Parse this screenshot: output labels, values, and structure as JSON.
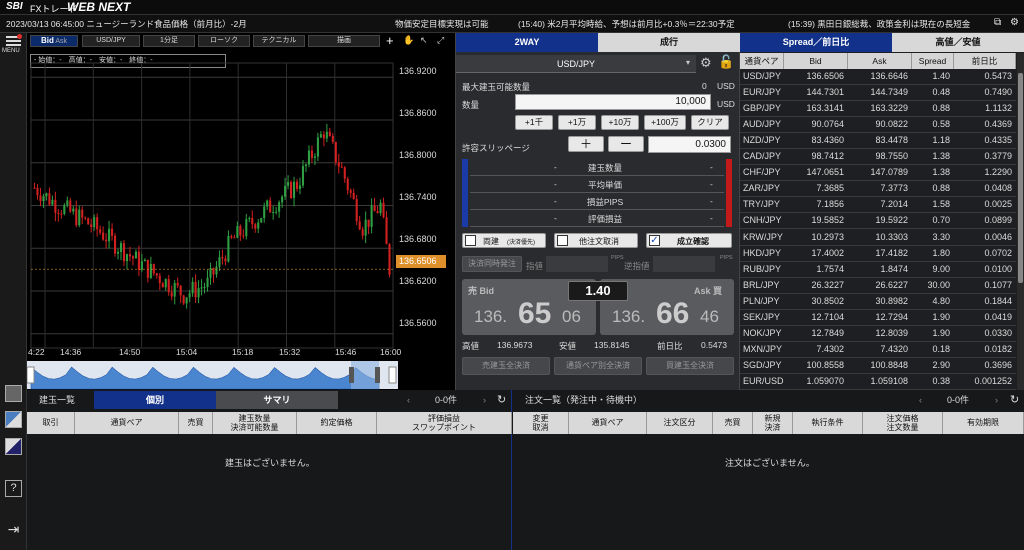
{
  "app": {
    "brand_sbi": "SBI",
    "brand_fx": "FXトレード",
    "brand_web": "WEB NEXT"
  },
  "news": {
    "item1": "2023/03/13 06:45:00 ニュージーランド食品価格（前月比）-2月",
    "item2": "物価安定目標実現は可能",
    "item3": "(15:40) 米2月平均時給、予想は前月比+0.3％＝22:30予定",
    "item4": "(15:39) 黒田日銀総裁、政策金利は現在の長短金"
  },
  "rail": {
    "menu": "MENU"
  },
  "chart": {
    "toolbar": {
      "bid": "Bid",
      "ask": "Ask",
      "pair": "USD/JPY",
      "interval": "1分足",
      "type": "ローソク",
      "tech": "テクニカル",
      "draw": "描画",
      "plus": "+"
    },
    "ohlc_label": "- 始値：-　高値：-　安値：-　終値：-",
    "last_price": "136.6506",
    "chart_data": {
      "type": "candlestick",
      "ylim": [
        136.54,
        136.94
      ],
      "yticks": [
        "136.9200",
        "136.8600",
        "136.8000",
        "136.7400",
        "136.6800",
        "136.6200",
        "136.5600"
      ],
      "xticks": [
        "4:22",
        "14:36",
        "14:50",
        "15:04",
        "15:18",
        "15:32",
        "15:46",
        "16:00"
      ],
      "last": 136.6506
    }
  },
  "order": {
    "tabs": {
      "twoway": "2WAY",
      "market": "成行"
    },
    "pair": "USD/JPY",
    "max_label": "最大建玉可能数量",
    "max_value": "0",
    "max_unit": "USD",
    "qty_label": "数量",
    "qty_value": "10,000",
    "qty_unit": "USD",
    "quick": [
      "+1千",
      "+1万",
      "+10万",
      "+100万",
      "クリア"
    ],
    "slip_label": "許容スリッページ",
    "slip_value": "0.0300",
    "plus": "＋",
    "minus": "ー",
    "positions": [
      {
        "label": "建玉数量",
        "l": "-",
        "r": "-"
      },
      {
        "label": "平均単価",
        "l": "-",
        "r": "-"
      },
      {
        "label": "損益PIPS",
        "l": "-",
        "r": "-"
      },
      {
        "label": "評価損益",
        "l": "-",
        "r": "-"
      }
    ],
    "check_both": "両建",
    "check_both_sub": "(決済優先)",
    "check_cancel": "他注文取消",
    "check_confirm": "成立確認",
    "simul": "決済同時発注",
    "limit": "指値",
    "stop": "逆指値",
    "pips": "PIPS",
    "sell_label": "売 Bid",
    "buy_label": "Ask 買",
    "spread": "1.40",
    "bid_big": "136.",
    "bid_mid": "65",
    "bid_small": "06",
    "ask_big": "136.",
    "ask_mid": "66",
    "ask_small": "46",
    "high_label": "高値",
    "high": "136.9673",
    "low_label": "安値",
    "low": "135.8145",
    "chg_label": "前日比",
    "chg": "0.5473",
    "close_sell": "売建玉全決済",
    "close_pair": "通貨ペア別全決済",
    "close_buy": "買建玉全決済"
  },
  "rates": {
    "tab_spread": "Spread／前日比",
    "tab_hl": "高値／安値",
    "headers": [
      "通貨ペア",
      "Bid",
      "Ask",
      "Spread",
      "前日比"
    ],
    "rows": [
      [
        "USD/JPY",
        "136.6506",
        "136.6646",
        "1.40",
        "0.5473"
      ],
      [
        "EUR/JPY",
        "144.7301",
        "144.7349",
        "0.48",
        "0.7490"
      ],
      [
        "GBP/JPY",
        "163.3141",
        "163.3229",
        "0.88",
        "1.1132"
      ],
      [
        "AUD/JPY",
        "90.0764",
        "90.0822",
        "0.58",
        "0.4369"
      ],
      [
        "NZD/JPY",
        "83.4360",
        "83.4478",
        "1.18",
        "0.4335"
      ],
      [
        "CAD/JPY",
        "98.7412",
        "98.7550",
        "1.38",
        "0.3779"
      ],
      [
        "CHF/JPY",
        "147.0651",
        "147.0789",
        "1.38",
        "1.2290"
      ],
      [
        "ZAR/JPY",
        "7.3685",
        "7.3773",
        "0.88",
        "0.0408"
      ],
      [
        "TRY/JPY",
        "7.1856",
        "7.2014",
        "1.58",
        "0.0025"
      ],
      [
        "CNH/JPY",
        "19.5852",
        "19.5922",
        "0.70",
        "0.0899"
      ],
      [
        "KRW/JPY",
        "10.2973",
        "10.3303",
        "3.30",
        "0.0046"
      ],
      [
        "HKD/JPY",
        "17.4002",
        "17.4182",
        "1.80",
        "0.0702"
      ],
      [
        "RUB/JPY",
        "1.7574",
        "1.8474",
        "9.00",
        "0.0100"
      ],
      [
        "BRL/JPY",
        "26.3227",
        "26.6227",
        "30.00",
        "0.1077"
      ],
      [
        "PLN/JPY",
        "30.8502",
        "30.8982",
        "4.80",
        "0.1844"
      ],
      [
        "SEK/JPY",
        "12.7104",
        "12.7294",
        "1.90",
        "0.0419"
      ],
      [
        "NOK/JPY",
        "12.7849",
        "12.8039",
        "1.90",
        "0.0330"
      ],
      [
        "MXN/JPY",
        "7.4302",
        "7.4320",
        "0.18",
        "0.0182"
      ],
      [
        "SGD/JPY",
        "100.8558",
        "100.8848",
        "2.90",
        "0.3696"
      ],
      [
        "EUR/USD",
        "1.059070",
        "1.059108",
        "0.38",
        "0.001252"
      ]
    ]
  },
  "positions_panel": {
    "title": "建玉一覧",
    "tab1": "個別",
    "tab2": "サマリ",
    "count": "0-0件",
    "cols": [
      "取引",
      "通貨ペア",
      "売買",
      "建玉数量\n決済可能数量",
      "約定価格",
      "評価損益\nスワップポイント"
    ],
    "empty": "建玉はございません。"
  },
  "orders_panel": {
    "title": "注文一覧（発注中・待機中）",
    "count": "0-0件",
    "cols": [
      "変更\n取消",
      "通貨ペア",
      "注文区分",
      "売買",
      "新規\n決済",
      "執行条件",
      "注文価格\n注文数量",
      "有効期限"
    ],
    "empty": "注文はございません。"
  }
}
